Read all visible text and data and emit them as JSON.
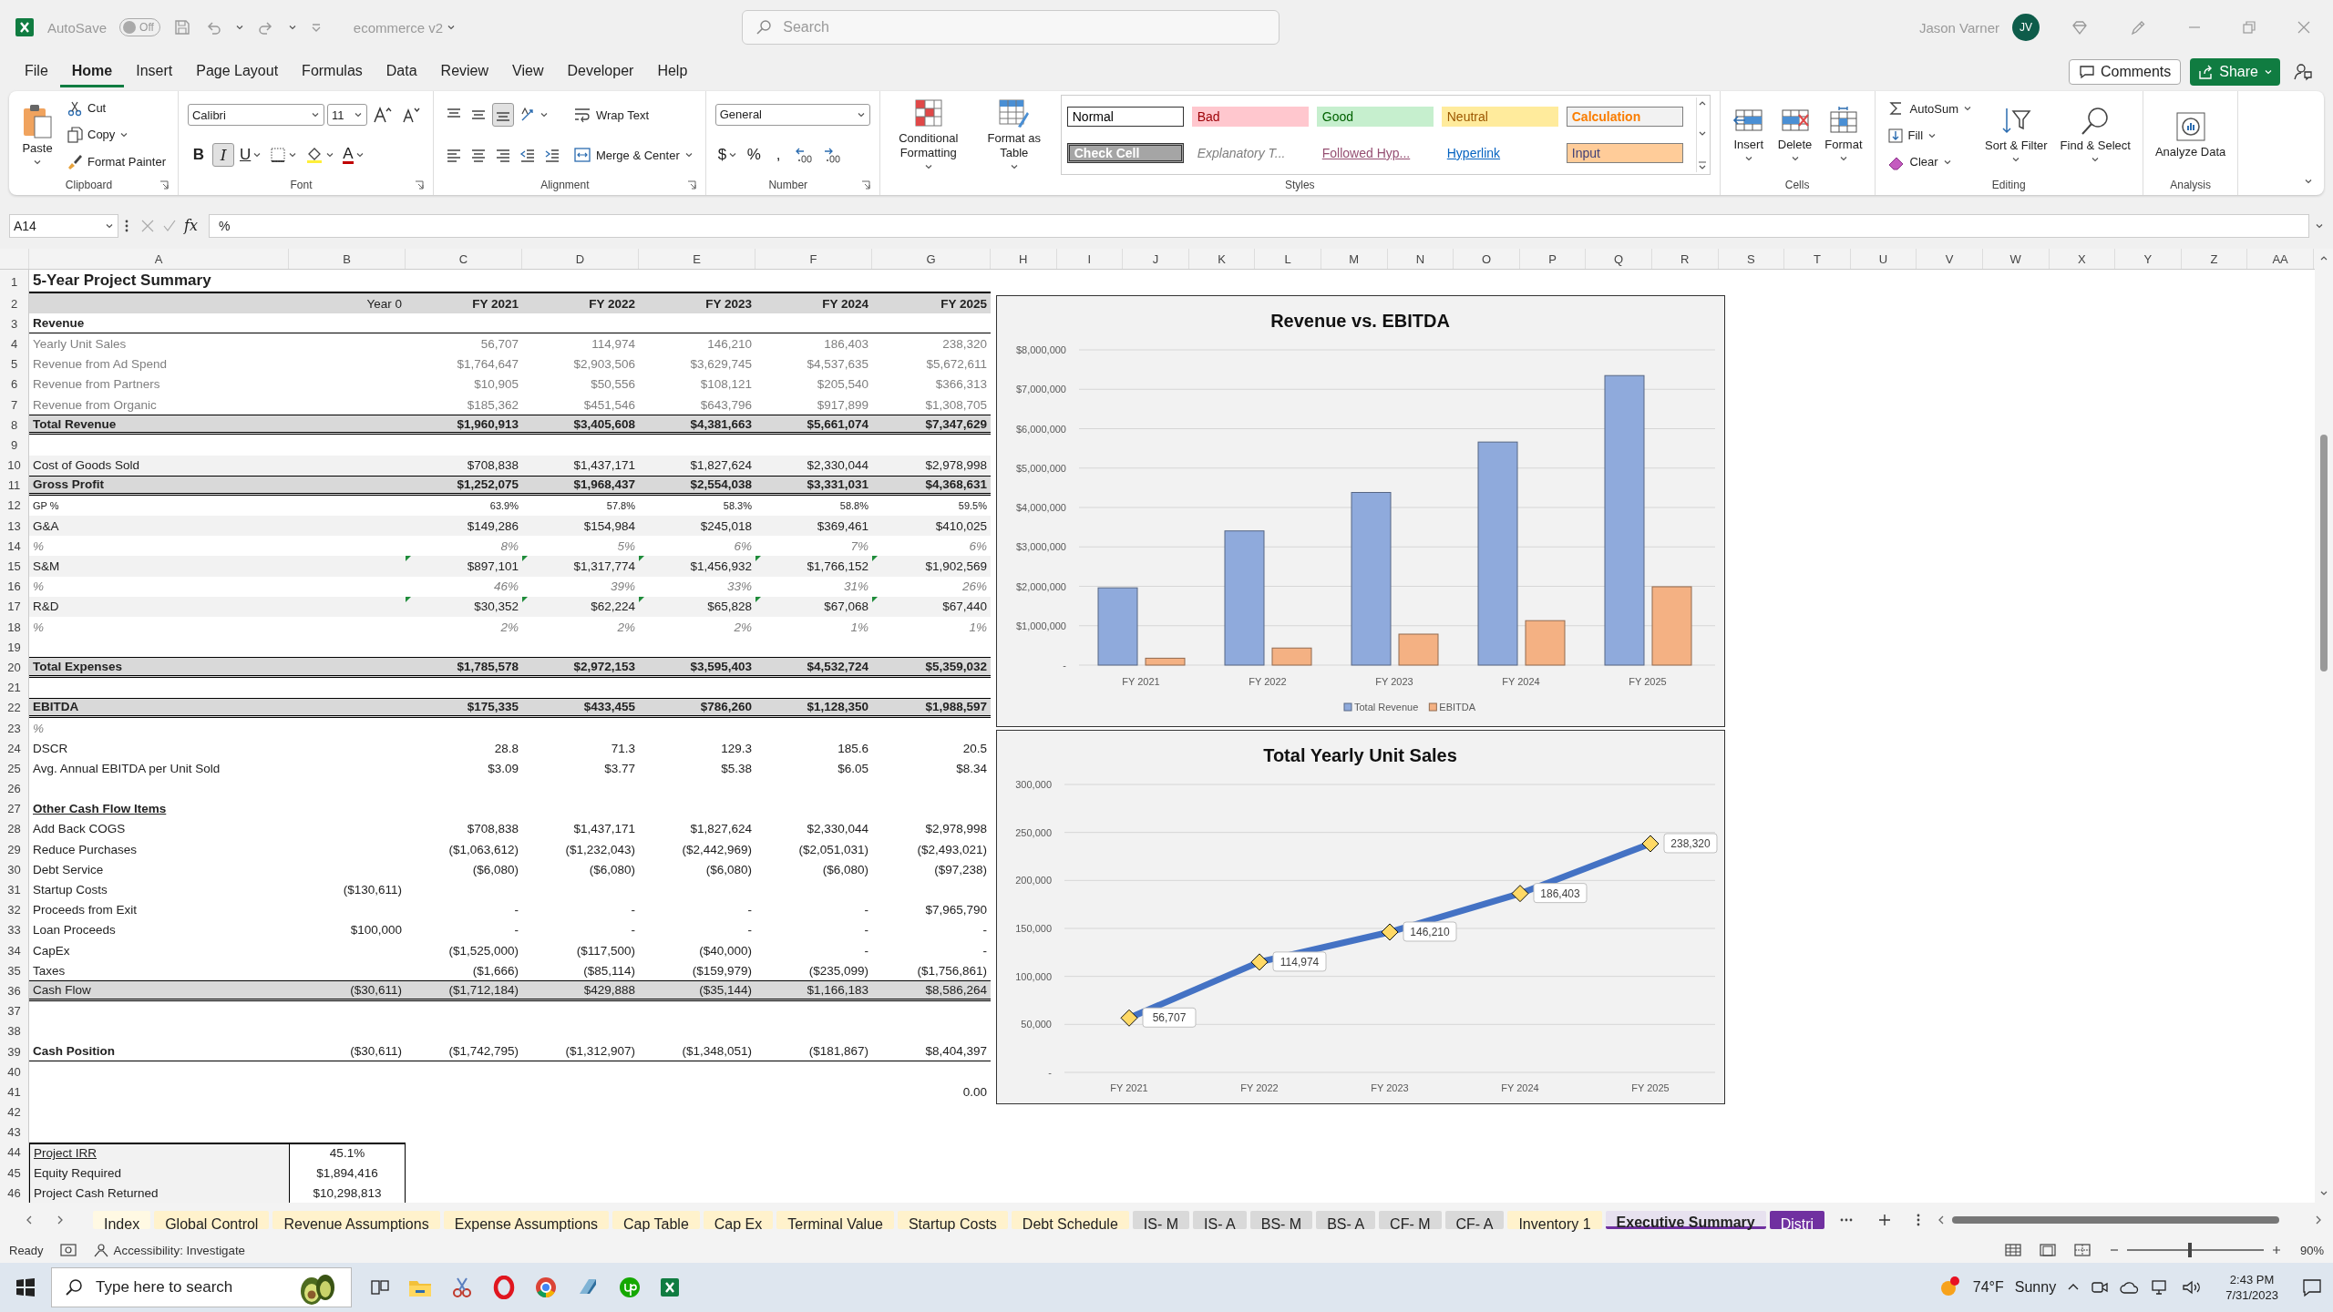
{
  "title_bar": {
    "autosave": "AutoSave",
    "autosave_switch": {
      "label": "Off",
      "on": false
    },
    "file_name": "ecommerce v2",
    "search": {
      "placeholder": "Search"
    },
    "user_name": "Jason Varner",
    "avatar": "JV"
  },
  "menu_tabs": [
    {
      "label": "File",
      "selected": false
    },
    {
      "label": "Home",
      "selected": true
    },
    {
      "label": "Insert",
      "selected": false
    },
    {
      "label": "Page Layout",
      "selected": false
    },
    {
      "label": "Formulas",
      "selected": false
    },
    {
      "label": "Data",
      "selected": false
    },
    {
      "label": "Review",
      "selected": false
    },
    {
      "label": "View",
      "selected": false
    },
    {
      "label": "Developer",
      "selected": false
    },
    {
      "label": "Help",
      "selected": false
    }
  ],
  "comments_button": "Comments",
  "share_button": "Share",
  "ribbon": [
    {
      "label": "Clipboard",
      "columns": [
        [
          [
            {
              "kind": "large",
              "label": "Paste",
              "caret": true
            }
          ]
        ],
        [
          [
            {
              "kind": "small",
              "label": "Cut",
              "caret": false
            }
          ],
          [
            {
              "kind": "small",
              "label": "Copy",
              "caret": true
            }
          ],
          [
            {
              "kind": "small",
              "label": "Format Painter",
              "caret": false
            }
          ]
        ]
      ]
    },
    {
      "label": "Font",
      "columns": [
        [
          [
            {
              "kind": "combo",
              "value": "Calibri"
            },
            {
              "kind": "combo",
              "value": "11"
            },
            {
              "kind": "tool",
              "on": false,
              "caret": false
            },
            {
              "kind": "tool",
              "on": false,
              "caret": false
            }
          ],
          [
            {
              "kind": "tool",
              "label": "B",
              "on": false,
              "caret": false
            },
            {
              "kind": "tool",
              "label": "I",
              "on": true,
              "caret": false
            },
            {
              "kind": "tool",
              "label": "U",
              "on": false,
              "caret": true
            },
            {
              "kind": "tool",
              "on": false,
              "caret": true
            },
            {
              "kind": "tool",
              "on": false,
              "caret": true
            },
            {
              "kind": "tool",
              "label": "A",
              "on": false,
              "caret": true
            }
          ]
        ]
      ]
    },
    {
      "label": "Alignment",
      "columns": [
        [
          [
            {
              "kind": "tool",
              "on": false,
              "caret": false
            },
            {
              "kind": "tool",
              "on": false,
              "caret": false
            },
            {
              "kind": "tool",
              "on": true,
              "caret": false
            },
            {
              "kind": "tool",
              "on": false,
              "caret": true
            }
          ],
          [
            {
              "kind": "tool",
              "on": false,
              "caret": false
            },
            {
              "kind": "tool",
              "on": false,
              "caret": false
            },
            {
              "kind": "tool",
              "on": false,
              "caret": false
            },
            {
              "kind": "tool",
              "on": false,
              "caret": false
            },
            {
              "kind": "tool",
              "on": false,
              "caret": false
            }
          ]
        ],
        [
          [
            {
              "kind": "small",
              "label": "Wrap Text",
              "caret": false
            }
          ],
          [
            {
              "kind": "small",
              "label": "Merge & Center",
              "caret": true
            }
          ]
        ]
      ]
    },
    {
      "label": "Number",
      "columns": [
        [
          [
            {
              "kind": "combo",
              "value": "General"
            }
          ],
          [
            {
              "kind": "tool",
              "label": "$",
              "on": false,
              "caret": true
            },
            {
              "kind": "tool",
              "label": "%",
              "on": false,
              "caret": false
            },
            {
              "kind": "tool",
              "label": ",",
              "on": false,
              "caret": false
            },
            {
              "kind": "tool",
              "on": false,
              "caret": false
            },
            {
              "kind": "tool",
              "on": false,
              "caret": false
            }
          ]
        ]
      ]
    },
    {
      "label": "Styles",
      "columns": [
        [
          [
            {
              "kind": "large",
              "label": "Conditional Formatting",
              "caret": true
            }
          ]
        ],
        [
          [
            {
              "kind": "large",
              "label": "Format as Table",
              "caret": true
            }
          ]
        ],
        [
          [
            {
              "kind": "normal",
              "label": "Normal",
              "color": "#ffffff"
            },
            {
              "kind": "bad",
              "label": "Bad",
              "color": "#ffc7ce"
            },
            {
              "kind": "good",
              "label": "Good",
              "color": "#c6efce"
            },
            {
              "kind": "neutral",
              "label": "Neutral",
              "color": "#ffeb9c"
            },
            {
              "kind": "calculation",
              "label": "Calculation",
              "color": "#f2f2f2"
            }
          ],
          [
            {
              "kind": "check",
              "label": "Check Cell",
              "color": "#a5a5a5"
            },
            {
              "kind": "explanatory",
              "label": "Explanatory T...",
              "color": "#ffffff"
            },
            {
              "kind": "followed",
              "label": "Followed Hyp...",
              "color": "#ffffff"
            },
            {
              "kind": "hyperlink",
              "label": "Hyperlink",
              "color": "#ffffff"
            },
            {
              "kind": "input",
              "label": "Input",
              "color": "#ffcc99"
            }
          ]
        ]
      ]
    },
    {
      "label": "Cells",
      "columns": [
        [
          [
            {
              "kind": "large",
              "label": "Insert",
              "caret": true
            }
          ]
        ],
        [
          [
            {
              "kind": "large",
              "label": "Delete",
              "caret": true
            }
          ]
        ],
        [
          [
            {
              "kind": "large",
              "label": "Format",
              "caret": true
            }
          ]
        ]
      ]
    },
    {
      "label": "Editing",
      "columns": [
        [
          [
            {
              "kind": "small",
              "label": "AutoSum",
              "caret": true
            }
          ],
          [
            {
              "kind": "small",
              "label": "Fill",
              "caret": true
            }
          ],
          [
            {
              "kind": "small",
              "label": "Clear",
              "caret": true
            }
          ]
        ],
        [
          [
            {
              "kind": "large",
              "label": "Sort & Filter",
              "caret": true
            }
          ]
        ],
        [
          [
            {
              "kind": "large",
              "label": "Find & Select",
              "caret": true
            }
          ]
        ]
      ]
    },
    {
      "label": "Analysis",
      "columns": [
        [
          [
            {
              "kind": "large",
              "label": "Analyze Data",
              "caret": false
            }
          ]
        ]
      ]
    }
  ],
  "formula_bar": {
    "name_box": "A14",
    "fx": "fx",
    "formula": "%"
  },
  "sheet": {
    "column_headers": [
      "A",
      "B",
      "C",
      "D",
      "E",
      "F",
      "G",
      "H",
      "I",
      "J",
      "K",
      "L",
      "M",
      "N",
      "O",
      "P",
      "Q",
      "R",
      "S",
      "T",
      "U",
      "V",
      "W",
      "X",
      "Y",
      "Z",
      "AA"
    ],
    "rows": [
      {
        "number": "1",
        "kind": "title",
        "cells": {
          "A": "5-Year Project Summary"
        }
      },
      {
        "number": "2",
        "kind": "header",
        "cells": {
          "B": "Year 0",
          "C": "FY 2021",
          "D": "FY 2022",
          "E": "FY 2023",
          "F": "FY 2024",
          "G": "FY 2025"
        }
      },
      {
        "number": "3",
        "kind": "section",
        "cells": {
          "A": "Revenue"
        }
      },
      {
        "number": "4",
        "kind": "muted",
        "cells": {
          "A": "Yearly Unit Sales",
          "C": "56,707",
          "D": "114,974",
          "E": "146,210",
          "F": "186,403",
          "G": "238,320"
        }
      },
      {
        "number": "5",
        "kind": "muted",
        "cells": {
          "A": "Revenue from Ad Spend",
          "C": "$1,764,647",
          "D": "$2,903,506",
          "E": "$3,629,745",
          "F": "$4,537,635",
          "G": "$5,672,611"
        }
      },
      {
        "number": "6",
        "kind": "muted",
        "cells": {
          "A": "Revenue from Partners",
          "C": "$10,905",
          "D": "$50,556",
          "E": "$108,121",
          "F": "$205,540",
          "G": "$366,313"
        }
      },
      {
        "number": "7",
        "kind": "muted",
        "cells": {
          "A": "Revenue from Organic",
          "C": "$185,362",
          "D": "$451,546",
          "E": "$643,796",
          "F": "$917,899",
          "G": "$1,308,705"
        }
      },
      {
        "number": "8",
        "kind": "total",
        "cells": {
          "A": "Total Revenue",
          "C": "$1,960,913",
          "D": "$3,405,608",
          "E": "$4,381,663",
          "F": "$5,661,074",
          "G": "$7,347,629"
        }
      },
      {
        "number": "9",
        "kind": "plain"
      },
      {
        "number": "10",
        "kind": "band",
        "cells": {
          "A": "Cost of Goods Sold",
          "C": "$708,838",
          "D": "$1,437,171",
          "E": "$1,827,624",
          "F": "$2,330,044",
          "G": "$2,978,998"
        }
      },
      {
        "number": "11",
        "kind": "total",
        "cells": {
          "A": "Gross Profit",
          "C": "$1,252,075",
          "D": "$1,968,437",
          "E": "$2,554,038",
          "F": "$3,331,031",
          "G": "$4,368,631"
        }
      },
      {
        "number": "12",
        "kind": "small",
        "cells": {
          "A": "GP %",
          "C": "63.9%",
          "D": "57.8%",
          "E": "58.3%",
          "F": "58.8%",
          "G": "59.5%"
        }
      },
      {
        "number": "13",
        "kind": "band",
        "cells": {
          "A": "G&A",
          "C": "$149,286",
          "D": "$154,984",
          "E": "$245,018",
          "F": "$369,461",
          "G": "$410,025"
        }
      },
      {
        "number": "14",
        "kind": "pct",
        "cells": {
          "A": "%",
          "C": "8%",
          "D": "5%",
          "E": "6%",
          "F": "7%",
          "G": "6%"
        }
      },
      {
        "number": "15",
        "kind": "band",
        "flagged": true,
        "cells": {
          "A": "S&M",
          "C": "$897,101",
          "D": "$1,317,774",
          "E": "$1,456,932",
          "F": "$1,766,152",
          "G": "$1,902,569"
        }
      },
      {
        "number": "16",
        "kind": "pct",
        "cells": {
          "A": "%",
          "C": "46%",
          "D": "39%",
          "E": "33%",
          "F": "31%",
          "G": "26%"
        }
      },
      {
        "number": "17",
        "kind": "band",
        "flagged": true,
        "cells": {
          "A": "R&D",
          "C": "$30,352",
          "D": "$62,224",
          "E": "$65,828",
          "F": "$67,068",
          "G": "$67,440"
        }
      },
      {
        "number": "18",
        "kind": "pct",
        "cells": {
          "A": "%",
          "C": "2%",
          "D": "2%",
          "E": "2%",
          "F": "1%",
          "G": "1%"
        }
      },
      {
        "number": "19",
        "kind": "plain"
      },
      {
        "number": "20",
        "kind": "total",
        "cells": {
          "A": "Total Expenses",
          "C": "$1,785,578",
          "D": "$2,972,153",
          "E": "$3,595,403",
          "F": "$4,532,724",
          "G": "$5,359,032"
        }
      },
      {
        "number": "21",
        "kind": "plain"
      },
      {
        "number": "22",
        "kind": "total",
        "cells": {
          "A": "EBITDA",
          "C": "$175,335",
          "D": "$433,455",
          "E": "$786,260",
          "F": "$1,128,350",
          "G": "$1,988,597"
        }
      },
      {
        "number": "23",
        "kind": "pct",
        "cells": {
          "A": "%"
        }
      },
      {
        "number": "24",
        "kind": "plain",
        "cells": {
          "A": "DSCR",
          "C": "28.8",
          "D": "71.3",
          "E": "129.3",
          "F": "185.6",
          "G": "20.5"
        }
      },
      {
        "number": "25",
        "kind": "plain",
        "cells": {
          "A": "Avg. Annual EBITDA per Unit Sold",
          "C": "$3.09",
          "D": "$3.77",
          "E": "$5.38",
          "F": "$6.05",
          "G": "$8.34"
        }
      },
      {
        "number": "26",
        "kind": "plain"
      },
      {
        "number": "27",
        "kind": "heading",
        "cells": {
          "A": "Other Cash Flow Items"
        }
      },
      {
        "number": "28",
        "kind": "plain",
        "cells": {
          "A": "Add Back COGS",
          "C": "$708,838",
          "D": "$1,437,171",
          "E": "$1,827,624",
          "F": "$2,330,044",
          "G": "$2,978,998"
        }
      },
      {
        "number": "29",
        "kind": "plain",
        "cells": {
          "A": "Reduce Purchases",
          "C": "($1,063,612)",
          "D": "($1,232,043)",
          "E": "($2,442,969)",
          "F": "($2,051,031)",
          "G": "($2,493,021)"
        }
      },
      {
        "number": "30",
        "kind": "plain",
        "cells": {
          "A": "Debt Service",
          "C": "($6,080)",
          "D": "($6,080)",
          "E": "($6,080)",
          "F": "($6,080)",
          "G": "($97,238)"
        }
      },
      {
        "number": "31",
        "kind": "plain",
        "cells": {
          "A": "Startup Costs",
          "B": "($130,611)"
        }
      },
      {
        "number": "32",
        "kind": "plain",
        "cells": {
          "A": "Proceeds from Exit",
          "C": "-",
          "D": "-",
          "E": "-",
          "F": "-",
          "G": "$7,965,790"
        }
      },
      {
        "number": "33",
        "kind": "plain",
        "cells": {
          "A": "Loan Proceeds",
          "B": "$100,000",
          "C": "-",
          "D": "-",
          "E": "-",
          "F": "-",
          "G": "-"
        }
      },
      {
        "number": "34",
        "kind": "plain",
        "cells": {
          "A": "CapEx",
          "C": "($1,525,000)",
          "D": "($117,500)",
          "E": "($40,000)",
          "F": "-",
          "G": "-"
        }
      },
      {
        "number": "35",
        "kind": "plain",
        "cells": {
          "A": "Taxes",
          "C": "($1,666)",
          "D": "($85,114)",
          "E": "($159,979)",
          "F": "($235,099)",
          "G": "($1,756,861)"
        }
      },
      {
        "number": "36",
        "kind": "flow",
        "cells": {
          "A": "Cash Flow",
          "B": "($30,611)",
          "C": "($1,712,184)",
          "D": "$429,888",
          "E": "($35,144)",
          "F": "$1,166,183",
          "G": "$8,586,264"
        }
      },
      {
        "number": "37",
        "kind": "plain"
      },
      {
        "number": "38",
        "kind": "plain"
      },
      {
        "number": "39",
        "kind": "position",
        "cells": {
          "A": "Cash Position",
          "B": "($30,611)",
          "C": "($1,742,795)",
          "D": "($1,312,907)",
          "E": "($1,348,051)",
          "F": "($181,867)",
          "G": "$8,404,397"
        }
      },
      {
        "number": "40",
        "kind": "plain"
      },
      {
        "number": "41",
        "kind": "plain",
        "cells": {
          "G": "0.00"
        }
      },
      {
        "number": "42",
        "kind": "plain"
      },
      {
        "number": "43",
        "kind": "plain"
      },
      {
        "number": "44",
        "kind": "boxtop",
        "cells": {
          "A": "Project IRR",
          "B": "45.1%"
        }
      },
      {
        "number": "45",
        "kind": "box",
        "cells": {
          "A": "Equity Required",
          "B": "$1,894,416"
        }
      },
      {
        "number": "46",
        "kind": "box",
        "cells": {
          "A": "Project Cash Returned",
          "B": "$10,298,813"
        }
      }
    ]
  },
  "charts": [
    {
      "chart_data": {
        "type": "bar",
        "title": "Revenue vs. EBITDA",
        "categories": [
          "FY 2021",
          "FY 2022",
          "FY 2023",
          "FY 2024",
          "FY 2025"
        ],
        "series": [
          {
            "name": "Total Revenue",
            "color": "#8faadc",
            "values": [
              1960913,
              3405608,
              4381663,
              5661074,
              7347629
            ]
          },
          {
            "name": "EBITDA",
            "color": "#f4b183",
            "values": [
              175335,
              433455,
              786260,
              1128350,
              1988597
            ]
          }
        ],
        "ylim": [
          0,
          8000000
        ],
        "grid": true,
        "legend": true,
        "yticks": [
          {
            "value": 0,
            "label": "-"
          },
          {
            "value": 1000000,
            "label": "$1,000,000"
          },
          {
            "value": 2000000,
            "label": "$2,000,000"
          },
          {
            "value": 3000000,
            "label": "$3,000,000"
          },
          {
            "value": 4000000,
            "label": "$4,000,000"
          },
          {
            "value": 5000000,
            "label": "$5,000,000"
          },
          {
            "value": 6000000,
            "label": "$6,000,000"
          },
          {
            "value": 7000000,
            "label": "$7,000,000"
          },
          {
            "value": 8000000,
            "label": "$8,000,000"
          }
        ]
      }
    },
    {
      "chart_data": {
        "type": "line",
        "title": "Total Yearly Unit Sales",
        "categories": [
          "FY 2021",
          "FY 2022",
          "FY 2023",
          "FY 2024",
          "FY 2025"
        ],
        "series": [
          {
            "color": "#4472c4",
            "marker": "diamond",
            "values": [
              56707,
              114974,
              146210,
              186403,
              238320
            ]
          }
        ],
        "ylim": [
          0,
          300000
        ],
        "grid": true,
        "yticks": [
          {
            "value": 0,
            "label": "-"
          },
          {
            "value": 50000,
            "label": "50,000"
          },
          {
            "value": 100000,
            "label": "100,000"
          },
          {
            "value": 150000,
            "label": "150,000"
          },
          {
            "value": 200000,
            "label": "200,000"
          },
          {
            "value": 250000,
            "label": "250,000"
          },
          {
            "value": 300000,
            "label": "300,000"
          }
        ],
        "value_labels": [
          "56,707",
          "114,974",
          "146,210",
          "186,403",
          "238,320"
        ]
      }
    }
  ],
  "sheet_tabs": [
    {
      "label": "Index",
      "selected": false,
      "color": "#fff9e3"
    },
    {
      "label": "Global Control",
      "selected": false,
      "color": "#fff2cc"
    },
    {
      "label": "Revenue Assumptions",
      "selected": false,
      "color": "#fff2cc"
    },
    {
      "label": "Expense Assumptions",
      "selected": false,
      "color": "#fff2cc"
    },
    {
      "label": "Cap Table",
      "selected": false,
      "color": "#fff2cc"
    },
    {
      "label": "Cap Ex",
      "selected": false,
      "color": "#fff2cc"
    },
    {
      "label": "Terminal Value",
      "selected": false,
      "color": "#fff2cc"
    },
    {
      "label": "Startup Costs",
      "selected": false,
      "color": "#fff2cc"
    },
    {
      "label": "Debt Schedule",
      "selected": false,
      "color": "#fff2cc"
    },
    {
      "label": "IS- M",
      "selected": false,
      "color": "#d9d9d9"
    },
    {
      "label": "IS- A",
      "selected": false,
      "color": "#d9d9d9"
    },
    {
      "label": "BS- M",
      "selected": false,
      "color": "#d9d9d9"
    },
    {
      "label": "BS- A",
      "selected": false,
      "color": "#d9d9d9"
    },
    {
      "label": "CF- M",
      "selected": false,
      "color": "#d9d9d9"
    },
    {
      "label": "CF- A",
      "selected": false,
      "color": "#d9d9d9"
    },
    {
      "label": "Inventory 1",
      "selected": false,
      "color": "#fff2cc"
    },
    {
      "label": "Executive Summary",
      "selected": true,
      "color": "#7030a0"
    },
    {
      "label": "Distri",
      "selected": false,
      "color": "#7030a0"
    }
  ],
  "status_bar": {
    "status": "Ready",
    "accessibility": "Accessibility: Investigate",
    "zoom_slider": {
      "level": 0.45
    },
    "zoom": "90%"
  },
  "taskbar": {
    "search": {
      "placeholder": "Type here to search"
    },
    "temperature": "74°F",
    "weather": "Sunny",
    "time": "2:43 PM",
    "date": "7/31/2023"
  }
}
